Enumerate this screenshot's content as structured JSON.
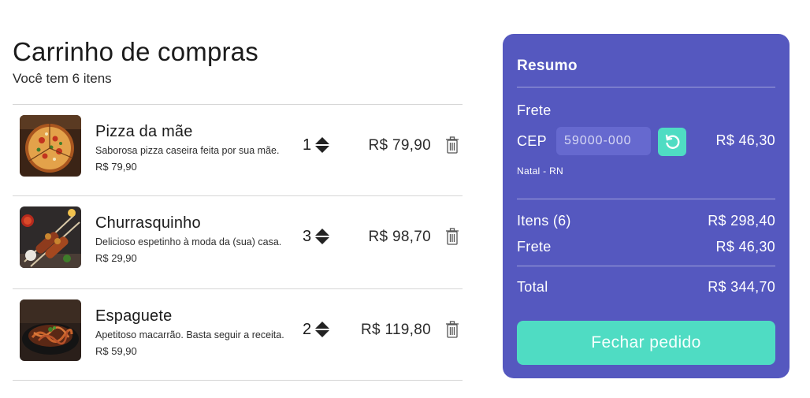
{
  "cart": {
    "title": "Carrinho de compras",
    "subtitle": "Você tem 6 itens",
    "items": [
      {
        "name": "Pizza da mãe",
        "description": "Saborosa pizza caseira feita por sua mãe.",
        "unit_price": "R$ 79,90",
        "quantity": "1",
        "total": "R$ 79,90"
      },
      {
        "name": "Churrasquinho",
        "description": "Delicioso espetinho à moda da (sua) casa.",
        "unit_price": "R$ 29,90",
        "quantity": "3",
        "total": "R$ 98,70"
      },
      {
        "name": "Espaguete",
        "description": "Apetitoso macarrão. Basta seguir a receita.",
        "unit_price": "R$ 59,90",
        "quantity": "2",
        "total": "R$ 119,80"
      }
    ]
  },
  "summary": {
    "title": "Resumo",
    "shipping_label": "Frete",
    "cep_label": "CEP",
    "cep_value": "59000-000",
    "cep_shipping_value": "R$ 46,30",
    "city": "Natal - RN",
    "items_label": "Itens (6)",
    "items_value": "R$ 298,40",
    "shipping_total_label": "Frete",
    "shipping_total_value": "R$ 46,30",
    "total_label": "Total",
    "total_value": "R$ 344,70",
    "checkout_label": "Fechar pedido"
  },
  "colors": {
    "panel": "#5558bf",
    "accent": "#4fdcc3",
    "input_bg": "#6669cf"
  },
  "icons": [
    "pizza-image",
    "skewers-image",
    "spaghetti-image",
    "sort-arrows-icon",
    "trash-icon",
    "refresh-icon"
  ]
}
